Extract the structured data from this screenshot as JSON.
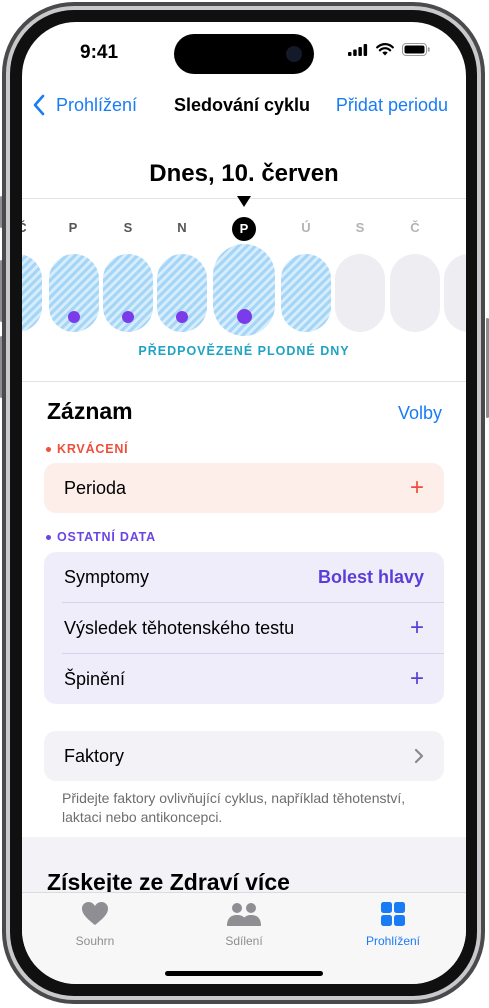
{
  "status": {
    "time": "9:41"
  },
  "nav": {
    "back_label": "Prohlížení",
    "title": "Sledování cyklu",
    "action_label": "Přidat periodu"
  },
  "calendar": {
    "date_title": "Dnes, 10. červen",
    "day_labels": [
      "Č",
      "P",
      "S",
      "N",
      "P",
      "Ú",
      "S",
      "Č"
    ],
    "fertile_label": "PŘEDPOVĚZENÉ PLODNÉ DNY"
  },
  "log": {
    "title": "Záznam",
    "options_label": "Volby",
    "bleeding": {
      "label": "KRVÁCENÍ",
      "period_label": "Perioda",
      "plus": "+"
    },
    "other": {
      "label": "OSTATNÍ DATA",
      "symptoms_label": "Symptomy",
      "symptoms_value": "Bolest hlavy",
      "pregnancy_label": "Výsledek těhotenského testu",
      "spotting_label": "Špinění",
      "plus": "+"
    },
    "factors": {
      "label": "Faktory",
      "hint": "Přidejte faktory ovlivňující cyklus, například těhotenství, laktaci nebo antikoncepci."
    }
  },
  "promo": {
    "title": "Získejte ze Zdraví více"
  },
  "tabs": [
    {
      "label": "Souhrn",
      "icon": "heart-icon"
    },
    {
      "label": "Sdílení",
      "icon": "people-icon"
    },
    {
      "label": "Prohlížení",
      "icon": "grid-icon"
    }
  ],
  "colors": {
    "accent": "#1a7cf5",
    "bleeding": "#ef4f3a",
    "bleeding_card": "#fdeeea",
    "other": "#6a45e6",
    "other_card": "#efedfa",
    "fertile": "#1fa3c3",
    "ovulation_dot": "#7b3bea"
  }
}
